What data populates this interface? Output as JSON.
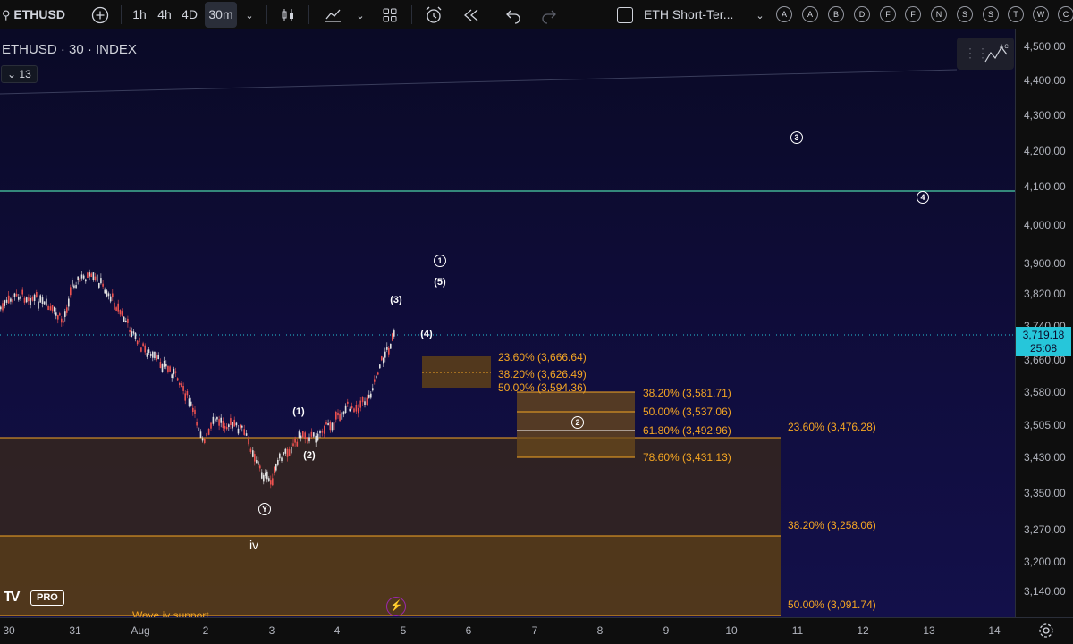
{
  "toolbar": {
    "symbol": "ETHUSD",
    "intervals": [
      "1h",
      "4h",
      "4D",
      "30m"
    ],
    "selected_interval": "30m",
    "layout_name": "ETH Short-Ter...",
    "alert_letters": [
      "A",
      "A",
      "B",
      "D",
      "F",
      "F",
      "N",
      "S",
      "S",
      "T",
      "W",
      "C"
    ]
  },
  "legend": {
    "title": "ETHUSD · 30 · INDEX",
    "indicators_count": "13"
  },
  "price_axis": {
    "ticks": [
      "4,500.00",
      "4,400.00",
      "4,300.00",
      "4,200.00",
      "4,100.00",
      "4,000.00",
      "3,900.00",
      "3,820.00",
      "3,740.00",
      "3,660.00",
      "3,580.00",
      "3,505.00",
      "3,430.00",
      "3,350.00",
      "3,270.00",
      "3,200.00",
      "3,140.00"
    ],
    "current_price": "3,719.18",
    "countdown": "25:08"
  },
  "time_axis": {
    "ticks": [
      "30",
      "31",
      "Aug",
      "2",
      "3",
      "4",
      "5",
      "6",
      "7",
      "8",
      "9",
      "10",
      "11",
      "12",
      "13",
      "14"
    ]
  },
  "fib_small": [
    "23.60% (3,666.64)",
    "38.20% (3,626.49)",
    "50.00% (3,594.36)"
  ],
  "fib_mid": [
    "38.20% (3,581.71)",
    "50.00% (3,537.06)",
    "61.80% (3,492.96)",
    "78.60% (3,431.13)"
  ],
  "fib_large": [
    "23.60% (3,476.28)",
    "38.20% (3,258.06)",
    "50.00% (3,091.74)"
  ],
  "waves": {
    "w1": "1",
    "w2": "2",
    "w3": "3",
    "w4": "4",
    "sub1": "(1)",
    "sub2": "(2)",
    "sub3": "(3)",
    "sub4": "(4)",
    "sub5": "(5)",
    "y": "Y",
    "iv": "iv"
  },
  "annotation": "Wave iv support",
  "logo_text": "PRO",
  "colors": {
    "accent_line": "#4cd3a8",
    "fib": "#f5a623",
    "price_label": "#26c6da"
  }
}
